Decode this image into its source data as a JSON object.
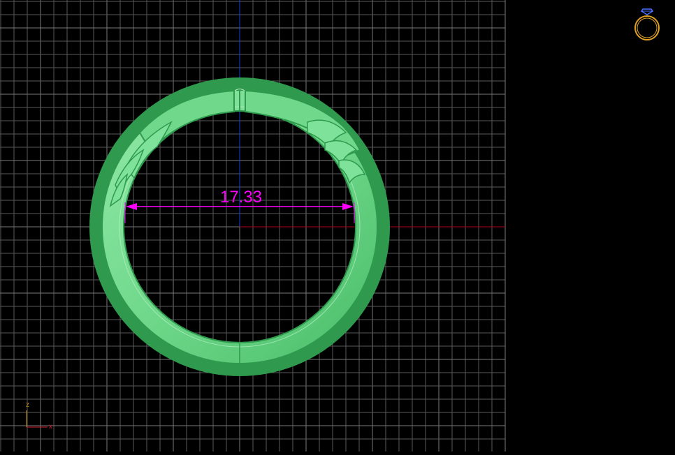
{
  "viewport": {
    "background": "#000000",
    "grid_color": "#5a5a5a",
    "grid_major_color": "#7a7a7a",
    "x_axis_color": "#b0001a",
    "y_axis_color": "#1a3fd6"
  },
  "ring": {
    "color": "#6fd88a",
    "edge_color": "#2f9a4d",
    "highlight_color": "#b8f3c6"
  },
  "dimension": {
    "value": "17.33",
    "color": "#ff00ff"
  },
  "axis_triad": {
    "z_label": "z",
    "x_label": "x",
    "color": "#c08a18"
  },
  "preview": {
    "icon": "ring-icon",
    "ring_color": "#e0a020",
    "gem_color": "#4a70ff"
  }
}
